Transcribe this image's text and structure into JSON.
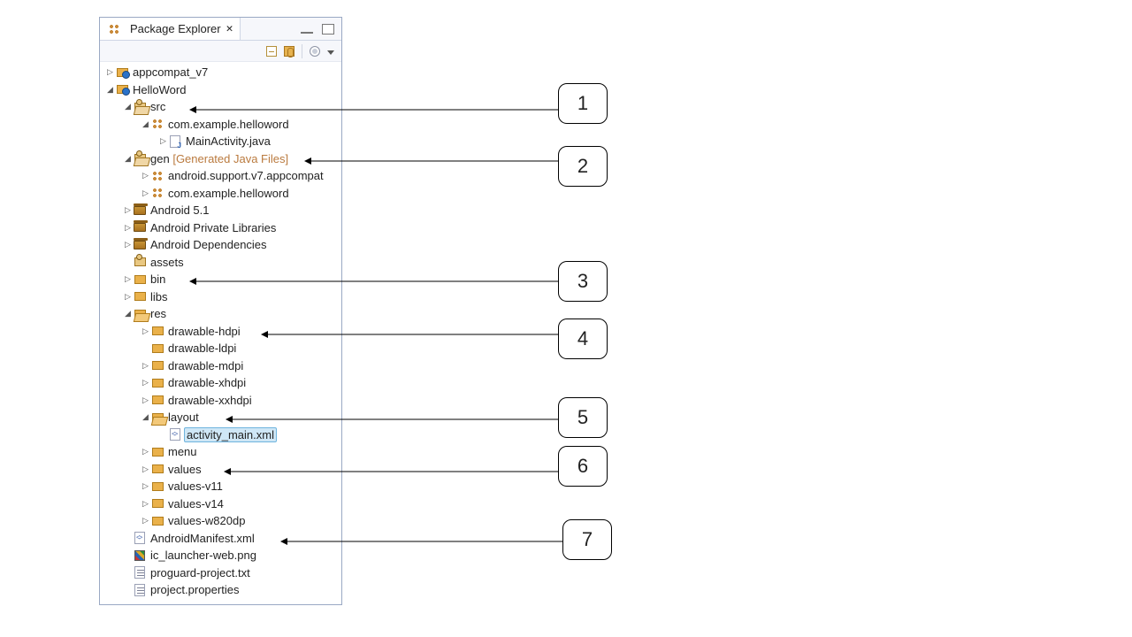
{
  "view": {
    "title": "Package Explorer",
    "close_glyph": "✕"
  },
  "tree": {
    "appcompat": "appcompat_v7",
    "project": "HelloWord",
    "src": "src",
    "pkg_hello": "com.example.helloword",
    "main_activity": "MainActivity.java",
    "gen": "gen",
    "gen_suffix": "[Generated Java Files]",
    "gen_pkg_support": "android.support.v7.appcompat",
    "gen_pkg_hello": "com.example.helloword",
    "android_51": "Android 5.1",
    "priv_libs": "Android Private Libraries",
    "deps": "Android Dependencies",
    "assets": "assets",
    "bin": "bin",
    "libs": "libs",
    "res": "res",
    "drawable_hdpi": "drawable-hdpi",
    "drawable_ldpi": "drawable-ldpi",
    "drawable_mdpi": "drawable-mdpi",
    "drawable_xhdpi": "drawable-xhdpi",
    "drawable_xxhdpi": "drawable-xxhdpi",
    "layout": "layout",
    "activity_main_xml": "activity_main.xml",
    "menu": "menu",
    "values": "values",
    "values_v11": "values-v11",
    "values_v14": "values-v14",
    "values_w820": "values-w820dp",
    "manifest": "AndroidManifest.xml",
    "ic_launcher_web": "ic_launcher-web.png",
    "proguard": "proguard-project.txt",
    "project_props": "project.properties"
  },
  "callouts": {
    "c1": "1",
    "c2": "2",
    "c3": "3",
    "c4": "4",
    "c5": "5",
    "c6": "6",
    "c7": "7"
  }
}
